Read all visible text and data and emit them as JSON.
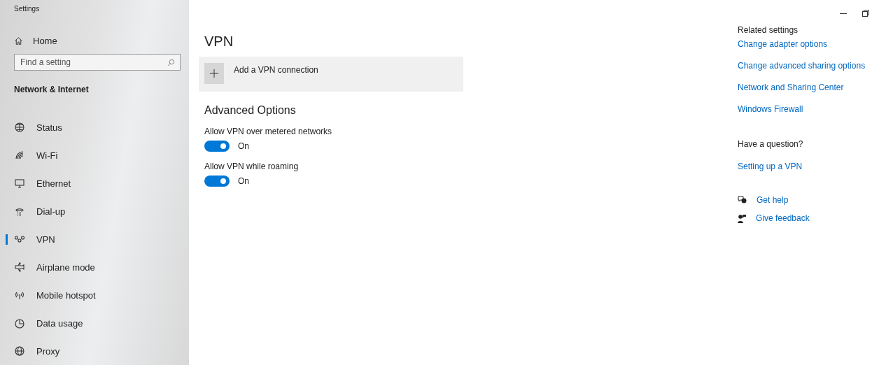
{
  "window": {
    "title": "Settings"
  },
  "sidebar": {
    "home": "Home",
    "search": {
      "placeholder": "Find a setting"
    },
    "section": "Network & Internet",
    "items": [
      {
        "label": "Status",
        "selected": false
      },
      {
        "label": "Wi-Fi",
        "selected": false
      },
      {
        "label": "Ethernet",
        "selected": false
      },
      {
        "label": "Dial-up",
        "selected": false
      },
      {
        "label": "VPN",
        "selected": true
      },
      {
        "label": "Airplane mode",
        "selected": false
      },
      {
        "label": "Mobile hotspot",
        "selected": false
      },
      {
        "label": "Data usage",
        "selected": false
      },
      {
        "label": "Proxy",
        "selected": false
      }
    ]
  },
  "main": {
    "title": "VPN",
    "add_connection": "Add a VPN connection",
    "advanced_title": "Advanced Options",
    "toggles": [
      {
        "label": "Allow VPN over metered networks",
        "on": true,
        "state": "On"
      },
      {
        "label": "Allow VPN while roaming",
        "on": true,
        "state": "On"
      }
    ]
  },
  "related": {
    "title": "Related settings",
    "links": [
      "Change adapter options",
      "Change advanced sharing options",
      "Network and Sharing Center",
      "Windows Firewall"
    ]
  },
  "question": {
    "title": "Have a question?",
    "links": [
      "Setting up a VPN"
    ]
  },
  "help": [
    {
      "kind": "help",
      "label": "Get help"
    },
    {
      "kind": "feedback",
      "label": "Give feedback"
    }
  ]
}
